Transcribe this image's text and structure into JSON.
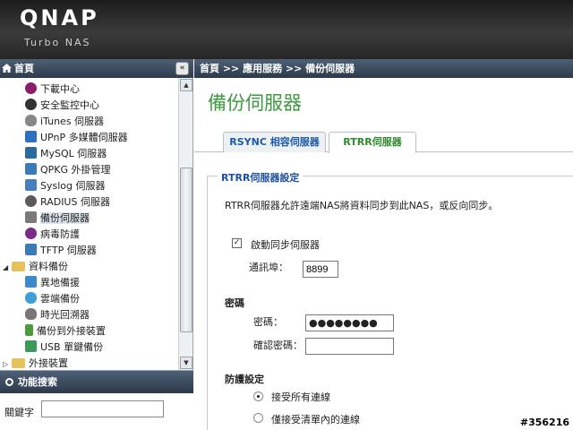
{
  "header": {
    "logo": "QNAP",
    "tagline": "Turbo NAS"
  },
  "sidebar": {
    "home_label": "首頁",
    "collapse_glyph": "«",
    "items": [
      {
        "label": "下載中心",
        "icon": "download-center-icon",
        "color": "#8b1e6b"
      },
      {
        "label": "安全監控中心",
        "icon": "surveillance-icon",
        "color": "#333333"
      },
      {
        "label": "iTunes 伺服器",
        "icon": "apple-icon",
        "color": "#888888"
      },
      {
        "label": "UPnP 多媒體伺服器",
        "icon": "upnp-icon",
        "color": "#2a6fc0"
      },
      {
        "label": "MySQL 伺服器",
        "icon": "mysql-icon",
        "color": "#2b6a9a"
      },
      {
        "label": "QPKG 外掛管理",
        "icon": "qpkg-icon",
        "color": "#3a7ab8"
      },
      {
        "label": "Syslog 伺服器",
        "icon": "syslog-icon",
        "color": "#4a7cc0"
      },
      {
        "label": "RADIUS 伺服器",
        "icon": "radius-icon",
        "color": "#5a5a5a"
      },
      {
        "label": "備份伺服器",
        "icon": "backup-server-icon",
        "color": "#7a7a7a",
        "selected": true
      },
      {
        "label": "病毒防護",
        "icon": "antivirus-icon",
        "color": "#7b2a8a"
      },
      {
        "label": "TFTP 伺服器",
        "icon": "tftp-icon",
        "color": "#3a7ab8"
      },
      {
        "label": "資料備份",
        "icon": "folder-icon",
        "color": "#e6c35a",
        "group": true
      },
      {
        "label": "異地備援",
        "icon": "remote-replication-icon",
        "color": "#3a8acc"
      },
      {
        "label": "雲端備份",
        "icon": "cloud-backup-icon",
        "color": "#3ea0d8"
      },
      {
        "label": "時光回溯器",
        "icon": "time-machine-icon",
        "color": "#777777"
      },
      {
        "label": "備份到外接裝置",
        "icon": "external-backup-icon",
        "color": "#4a9a3a"
      },
      {
        "label": "USB 單鍵備份",
        "icon": "usb-backup-icon",
        "color": "#3a9a5a"
      },
      {
        "label": "外接裝置",
        "icon": "folder-icon",
        "color": "#e6c35a",
        "group": true
      }
    ],
    "search": {
      "title": "功能搜索",
      "keyword_label": "關鍵字",
      "value": ""
    }
  },
  "main": {
    "breadcrumb": "首頁 >> 應用服務 >> 備份伺服器",
    "title": "備份伺服器",
    "tabs": [
      {
        "label": "RSYNC 相容伺服器"
      },
      {
        "label": "RTRR伺服器",
        "active": true
      }
    ],
    "section_title": "RTRR伺服器設定",
    "description": "RTRR伺服器允許遠端NAS將資料同步到此NAS，或反向同步。",
    "enable_label": "啟動同步伺服器",
    "enable_checked": true,
    "port_label": "通訊埠：",
    "port_value": "8899",
    "password_head": "密碼",
    "password_label": "密碼：",
    "password_value": "●●●●●●●●",
    "confirm_label": "確認密碼：",
    "confirm_value": "",
    "protection_head": "防護設定",
    "radio_all": "接受所有連線",
    "radio_list": "僅接受清單內的連線"
  },
  "watermark": "#356216",
  "colors": {
    "accent_green": "#3f9a3f",
    "header_blue": "#2c3a4a",
    "tab_link": "#1e5aa8"
  }
}
